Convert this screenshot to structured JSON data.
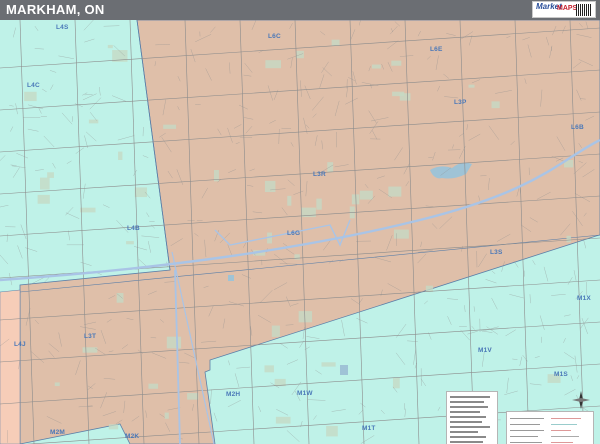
{
  "header": {
    "title": "MARKHAM, ON",
    "logo_text": "Market",
    "logo_text_2": "MAPS"
  },
  "map": {
    "colors": {
      "zone_tan": "#dfbfa9",
      "zone_cyan": "#bff2e8",
      "zone_peach": "#f6cdb8",
      "zone_border": "#5c7fa8",
      "highway": "#a9c4e6",
      "street": "#8c8c8c",
      "park": "#c6d9c4",
      "water": "#9fc3d6",
      "label": "#4a78b8"
    },
    "postal_codes": [
      {
        "code": "L4S"
      },
      {
        "code": "L6C"
      },
      {
        "code": "L6E"
      },
      {
        "code": "L4C"
      },
      {
        "code": "L3P"
      },
      {
        "code": "L6B"
      },
      {
        "code": "L3R"
      },
      {
        "code": "L4B"
      },
      {
        "code": "L6G"
      },
      {
        "code": "L3S"
      },
      {
        "code": "L4J"
      },
      {
        "code": "L3T"
      },
      {
        "code": "M1X"
      },
      {
        "code": "M1V"
      },
      {
        "code": "M1S"
      },
      {
        "code": "M2H"
      },
      {
        "code": "M1W"
      },
      {
        "code": "M2M"
      },
      {
        "code": "M2K"
      },
      {
        "code": "M1T"
      }
    ]
  }
}
